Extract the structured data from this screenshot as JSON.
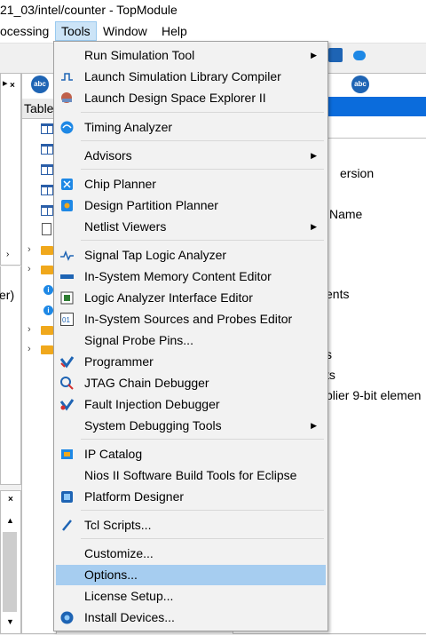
{
  "window": {
    "title": "21_03/intel/counter - TopModule"
  },
  "menubar": {
    "items": [
      "ocessing",
      "Tools",
      "Window",
      "Help"
    ]
  },
  "left_panel": {
    "tab_label": "Table",
    "partial_text": "er)"
  },
  "right_panel": {
    "fragments": [
      "ersion",
      "Name",
      "ents",
      "s",
      "ts",
      "plier 9-bit elemen"
    ]
  },
  "tools_menu": {
    "run_simulation_tool": "Run Simulation Tool",
    "launch_sim_lib_compiler": "Launch Simulation Library Compiler",
    "launch_dse": "Launch Design Space Explorer II",
    "timing_analyzer": "Timing Analyzer",
    "advisors": "Advisors",
    "chip_planner": "Chip Planner",
    "design_partition_planner": "Design Partition Planner",
    "netlist_viewers": "Netlist Viewers",
    "signal_tap": "Signal Tap Logic Analyzer",
    "in_system_memory": "In-System Memory Content Editor",
    "logic_analyzer_interface": "Logic Analyzer Interface Editor",
    "in_system_sources": "In-System Sources and Probes Editor",
    "signal_probe_pins": "Signal Probe Pins...",
    "programmer": "Programmer",
    "jtag_chain": "JTAG Chain Debugger",
    "fault_injection": "Fault Injection Debugger",
    "system_debugging": "System Debugging Tools",
    "ip_catalog": "IP Catalog",
    "nios_ii": "Nios II Software Build Tools for Eclipse",
    "platform_designer": "Platform Designer",
    "tcl_scripts": "Tcl Scripts...",
    "customize": "Customize...",
    "options": "Options...",
    "license_setup": "License Setup...",
    "install_devices": "Install Devices..."
  },
  "colors": {
    "highlight": "#a6cdf0",
    "accent_blue": "#0b6cdc",
    "menu_bg": "#f2f2f2"
  }
}
